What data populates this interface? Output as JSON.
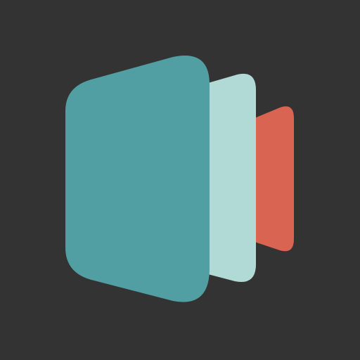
{
  "icon": {
    "name": "stacked-panels-logo",
    "colors": {
      "background": "#333333",
      "front_panel": "#519FA3",
      "middle_panel": "#B1D9D6",
      "back_panel": "#D96452"
    }
  }
}
